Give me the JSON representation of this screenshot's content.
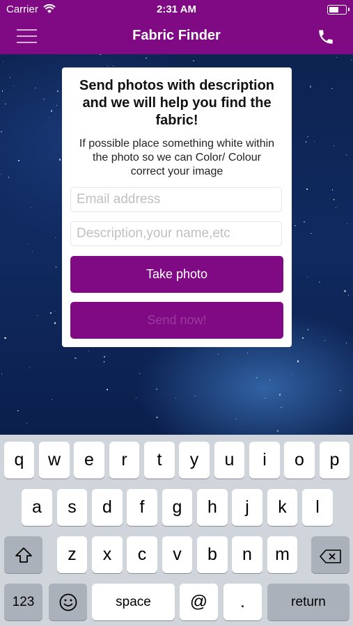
{
  "status_bar": {
    "carrier": "Carrier",
    "time": "2:31 AM"
  },
  "nav": {
    "title": "Fabric Finder",
    "menu_icon": "hamburger-menu-icon",
    "phone_icon": "phone-icon"
  },
  "card": {
    "heading": "Send photos with description and we will help you find the fabric!",
    "subtext": "If possible place something white within the photo so we can Color/ Colour correct your image",
    "email_placeholder": "Email address",
    "description_placeholder": "Description,your name,etc",
    "take_photo_label": "Take photo",
    "send_label": "Send now!"
  },
  "keyboard": {
    "row1": [
      "q",
      "w",
      "e",
      "r",
      "t",
      "y",
      "u",
      "i",
      "o",
      "p"
    ],
    "row2": [
      "a",
      "s",
      "d",
      "f",
      "g",
      "h",
      "j",
      "k",
      "l"
    ],
    "row3": [
      "z",
      "x",
      "c",
      "v",
      "b",
      "n",
      "m"
    ],
    "numbers_label": "123",
    "space_label": "space",
    "at_label": "@",
    "dot_label": ".",
    "return_label": "return"
  },
  "colors": {
    "brand": "#800a84",
    "keyboard_bg": "#d0d4db"
  }
}
